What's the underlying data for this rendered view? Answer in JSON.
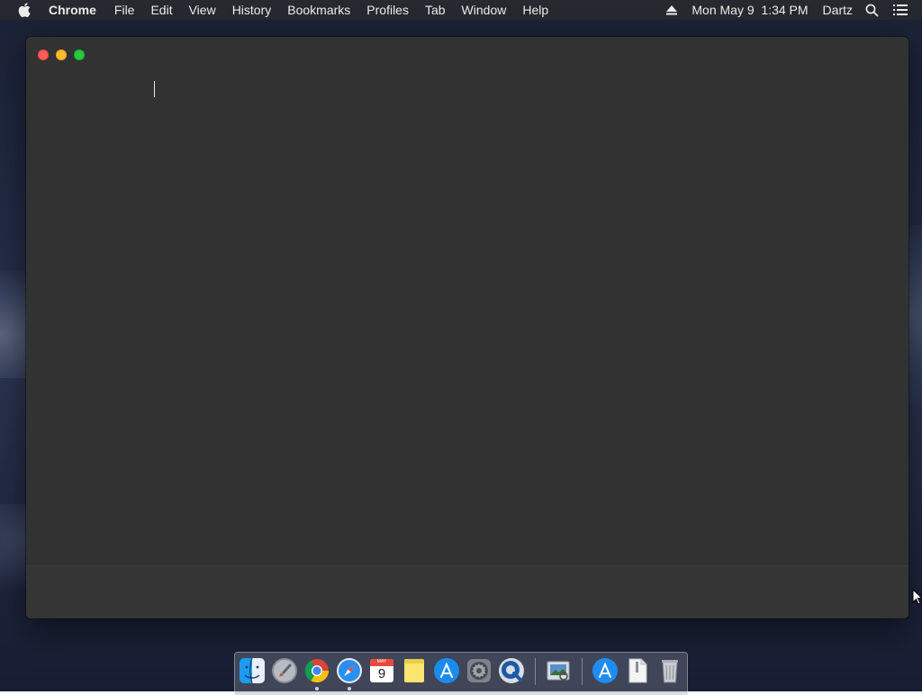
{
  "menubar": {
    "apple_icon": "apple-icon",
    "app_name": "Chrome",
    "items": [
      "File",
      "Edit",
      "View",
      "History",
      "Bookmarks",
      "Profiles",
      "Tab",
      "Window",
      "Help"
    ],
    "status": {
      "eject_icon": "eject-icon",
      "clock": "Mon May 9  1:34 PM",
      "user": "Dartz",
      "spotlight_icon": "search-icon",
      "notification_icon": "list-icon"
    }
  },
  "window": {
    "controls": [
      "close",
      "minimize",
      "zoom"
    ],
    "content_text": ""
  },
  "dock": {
    "apps": [
      {
        "name": "finder",
        "running": false
      },
      {
        "name": "launchpad",
        "running": false
      },
      {
        "name": "chrome",
        "running": true
      },
      {
        "name": "safari",
        "running": true
      },
      {
        "name": "calendar",
        "running": false,
        "month": "MAY",
        "day": "9"
      },
      {
        "name": "notes",
        "running": false
      },
      {
        "name": "app-store",
        "running": false
      },
      {
        "name": "system-preferences",
        "running": false
      },
      {
        "name": "quicktime",
        "running": false
      }
    ],
    "documents": [
      {
        "name": "preview"
      },
      {
        "name": "applications-folder"
      },
      {
        "name": "document"
      },
      {
        "name": "trash"
      }
    ]
  },
  "colors": {
    "menubar_bg": "#262a30",
    "window_bg": "#323232",
    "close": "#fd5e57",
    "minimize": "#febb2e",
    "zoom": "#29c840"
  }
}
